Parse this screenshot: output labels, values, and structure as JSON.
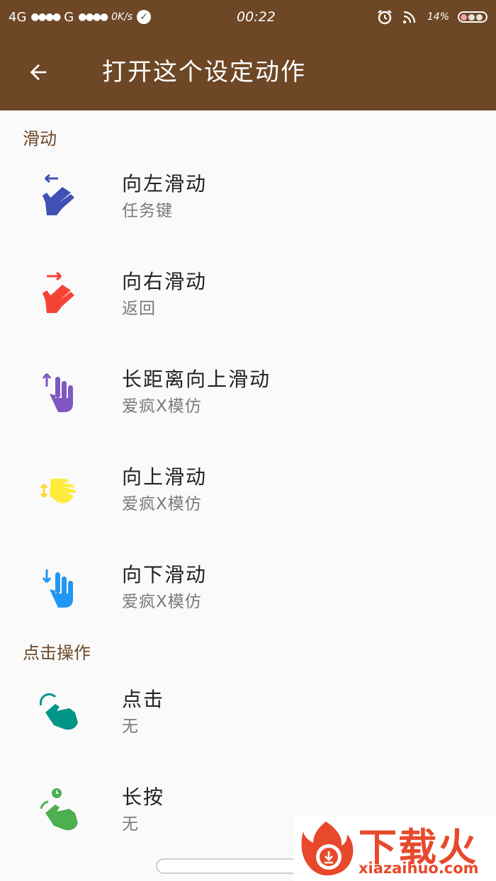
{
  "status_bar": {
    "network1": "4G",
    "signal1": "●●●●",
    "network2": "G",
    "signal2": "●●●●",
    "speed": "0K/s",
    "time": "00:22",
    "battery": "14%"
  },
  "toolbar": {
    "title": "打开这个设定动作"
  },
  "sections": [
    {
      "header": "滑动",
      "items": [
        {
          "title": "向左滑动",
          "subtitle": "任务键",
          "icon": "swipe-left-icon",
          "color": "#3f51b5"
        },
        {
          "title": "向右滑动",
          "subtitle": "返回",
          "icon": "swipe-right-icon",
          "color": "#f44336"
        },
        {
          "title": "长距离向上滑动",
          "subtitle": "爱疯X模仿",
          "icon": "long-swipe-up-icon",
          "color": "#7e57c2"
        },
        {
          "title": "向上滑动",
          "subtitle": "爱疯X模仿",
          "icon": "swipe-up-icon",
          "color": "#ffeb3b"
        },
        {
          "title": "向下滑动",
          "subtitle": "爱疯X模仿",
          "icon": "swipe-down-icon",
          "color": "#2196f3"
        }
      ]
    },
    {
      "header": "点击操作",
      "items": [
        {
          "title": "点击",
          "subtitle": "无",
          "icon": "tap-icon",
          "color": "#009688"
        },
        {
          "title": "长按",
          "subtitle": "无",
          "icon": "long-press-icon",
          "color": "#4caf50"
        }
      ]
    }
  ],
  "watermark": {
    "text": "下载火",
    "domain": "xiazaihuo.com",
    "color": "#e8492c"
  }
}
